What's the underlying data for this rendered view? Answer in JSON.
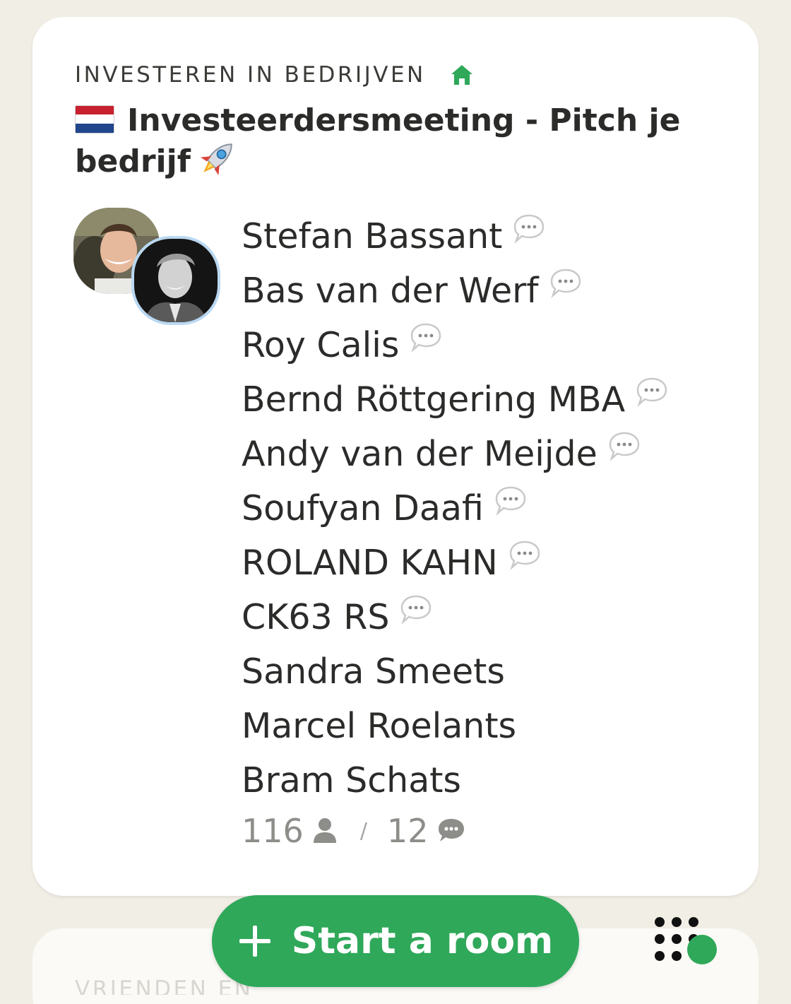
{
  "colors": {
    "background": "#f1eee6",
    "card": "#ffffff",
    "accent_green": "#2fa85a",
    "text": "#2b2b2a",
    "muted": "#8d8d8a"
  },
  "room": {
    "club_name": "INVESTEREN IN BEDRIJVEN",
    "club_icon": "home-icon",
    "title": "Investeerdersmeeting - Pitch je bedrijf",
    "title_prefix_icon": "netherlands-flag-icon",
    "title_suffix_icon": "rocket-icon",
    "avatars": [
      "avatar-1",
      "avatar-2"
    ],
    "speakers": [
      {
        "name": "Stefan Bassant",
        "speaking": true
      },
      {
        "name": "Bas van der Werf",
        "speaking": true
      },
      {
        "name": "Roy Calis",
        "speaking": true
      },
      {
        "name": "Bernd Röttgering MBA",
        "speaking": true
      },
      {
        "name": "Andy van der Meijde",
        "speaking": true
      },
      {
        "name": "Soufyan Daafi",
        "speaking": true
      },
      {
        "name": "ROLAND KAHN",
        "speaking": true
      },
      {
        "name": "CK63 RS",
        "speaking": true
      },
      {
        "name": "Sandra Smeets",
        "speaking": false
      },
      {
        "name": "Marcel Roelants",
        "speaking": false
      },
      {
        "name": "Bram Schats",
        "speaking": false
      }
    ],
    "listener_count": "116",
    "speaker_count": "12",
    "separator": "/"
  },
  "next_room": {
    "club_name": "VRIENDEN EN"
  },
  "actions": {
    "start_room_label": "Start a room",
    "start_room_icon": "plus-icon",
    "grid_icon": "dot-grid-icon"
  }
}
